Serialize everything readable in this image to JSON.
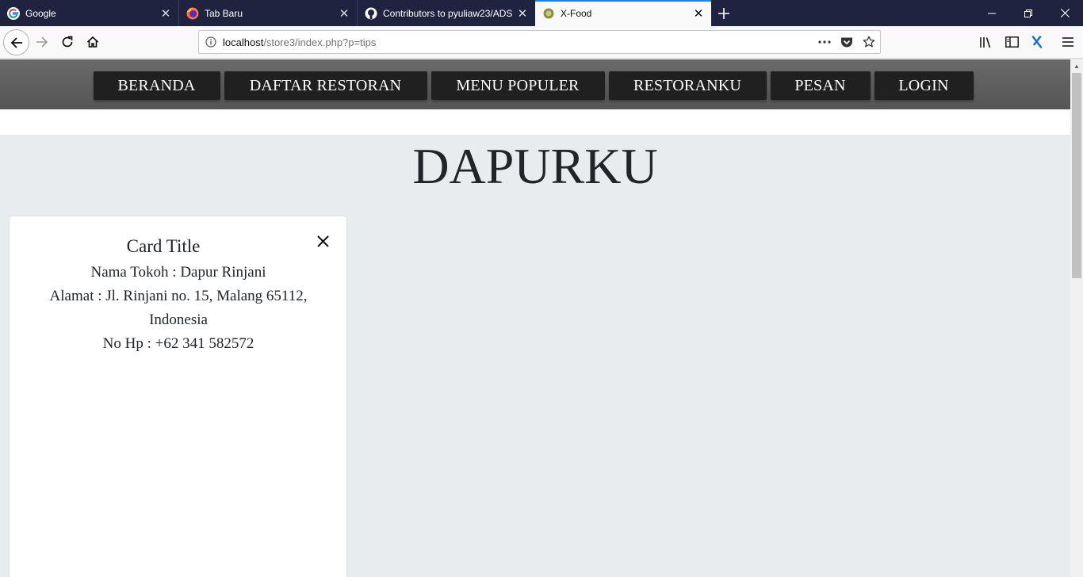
{
  "browser": {
    "tabs": [
      {
        "title": "Google",
        "icon": "google-icon",
        "active": false
      },
      {
        "title": "Tab Baru",
        "icon": "firefox-icon",
        "active": false
      },
      {
        "title": "Contributors to pyuliaw23/ADS",
        "icon": "github-icon",
        "active": false
      },
      {
        "title": "X-Food",
        "icon": "xfood-icon",
        "active": true
      }
    ],
    "url_host": "localhost",
    "url_path": "/store3/index.php?p=tips",
    "accent_color": "#0a84ff",
    "tabbar_color": "#202340"
  },
  "site": {
    "nav_items": [
      "BERANDA",
      "DAFTAR RESTORAN",
      "MENU POPULER",
      "RESTORANKU",
      "PESAN",
      "LOGIN"
    ],
    "page_title": "DAPURKU",
    "card": {
      "title": "Card Title",
      "store_name": "Nama Tokoh : Dapur Rinjani",
      "address_line1": "Alamat : Jl. Rinjani no. 15, Malang 65112,",
      "address_line2": "Indonesia",
      "phone": "No Hp : +62 341 582572"
    }
  }
}
